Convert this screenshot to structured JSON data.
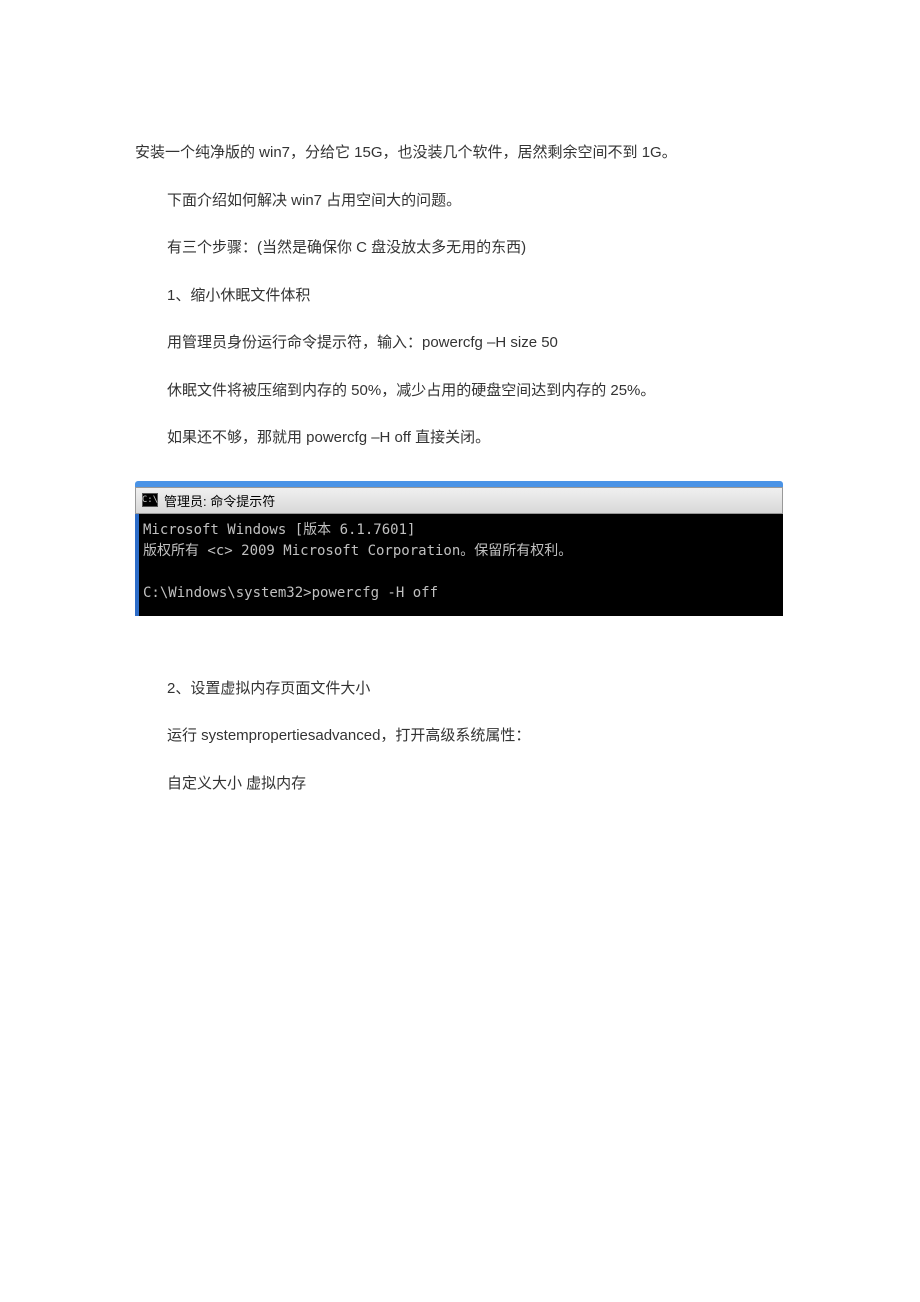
{
  "article": {
    "p1": "安装一个纯净版的 win7，分给它 15G，也没装几个软件，居然剩余空间不到 1G。",
    "p2": "下面介绍如何解决 win7 占用空间大的问题。",
    "p3": "有三个步骤：(当然是确保你 C 盘没放太多无用的东西)",
    "p4": "1、缩小休眠文件体积",
    "p5": "用管理员身份运行命令提示符，输入：powercfg –H size 50",
    "p6": "休眠文件将被压缩到内存的 50%，减少占用的硬盘空间达到内存的 25%。",
    "p7": "如果还不够，那就用 powercfg –H off  直接关闭。",
    "p8": "2、设置虚拟内存页面文件大小",
    "p9": "运行 systempropertiesadvanced，打开高级系统属性：",
    "p10": "自定义大小 虚拟内存"
  },
  "terminal": {
    "icon_text": "C:\\",
    "title": "管理员: 命令提示符",
    "line1": "Microsoft Windows [版本 6.1.7601]",
    "line2": "版权所有 <c> 2009 Microsoft Corporation。保留所有权利。",
    "line3": "C:\\Windows\\system32>powercfg -H off"
  }
}
